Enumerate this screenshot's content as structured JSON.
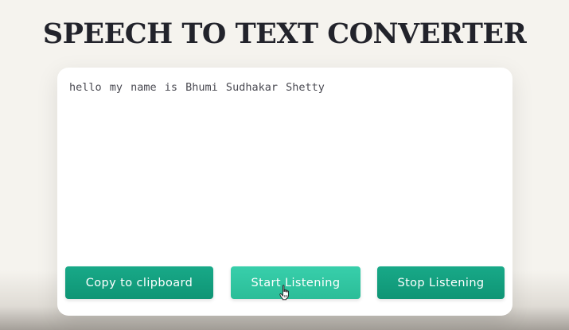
{
  "header": {
    "title": "SPEECH TO TEXT CONVERTER"
  },
  "transcript": {
    "text": "hello my name is Bhumi Sudhakar Shetty"
  },
  "buttons": {
    "copy_label": "Copy to clipboard",
    "start_label": "Start Listening",
    "stop_label": "Stop Listening"
  },
  "colors": {
    "background": "#f5f3ee",
    "title": "#22232b",
    "button_primary": "#13a080",
    "button_active": "#32c6a2",
    "button_text": "#ffffff"
  },
  "icons": {
    "cursor": "hand-pointer-icon"
  }
}
